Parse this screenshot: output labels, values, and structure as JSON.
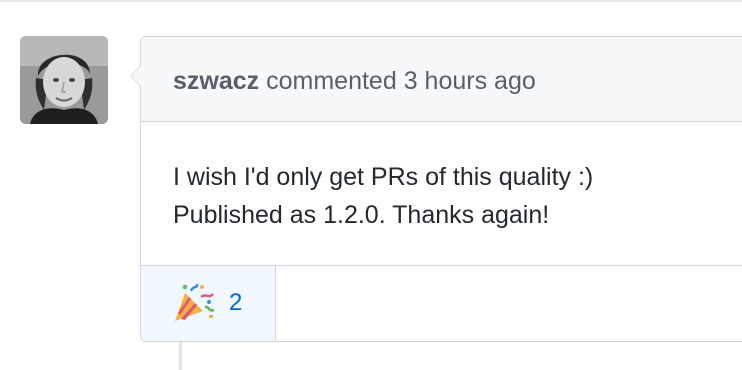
{
  "comment": {
    "author": "szwacz",
    "action": "commented",
    "time": "3 hours ago",
    "body_lines": [
      "I wish I'd only get PRs of this quality :)",
      "Published as 1.2.0. Thanks again!"
    ]
  },
  "reactions": [
    {
      "emoji_icon": "party-popper-icon",
      "count": "2"
    }
  ],
  "colors": {
    "header_bg": "#f6f8fa",
    "border": "#d1d5da",
    "reaction_bg": "#f1f8ff",
    "link_blue": "#0366d6"
  }
}
